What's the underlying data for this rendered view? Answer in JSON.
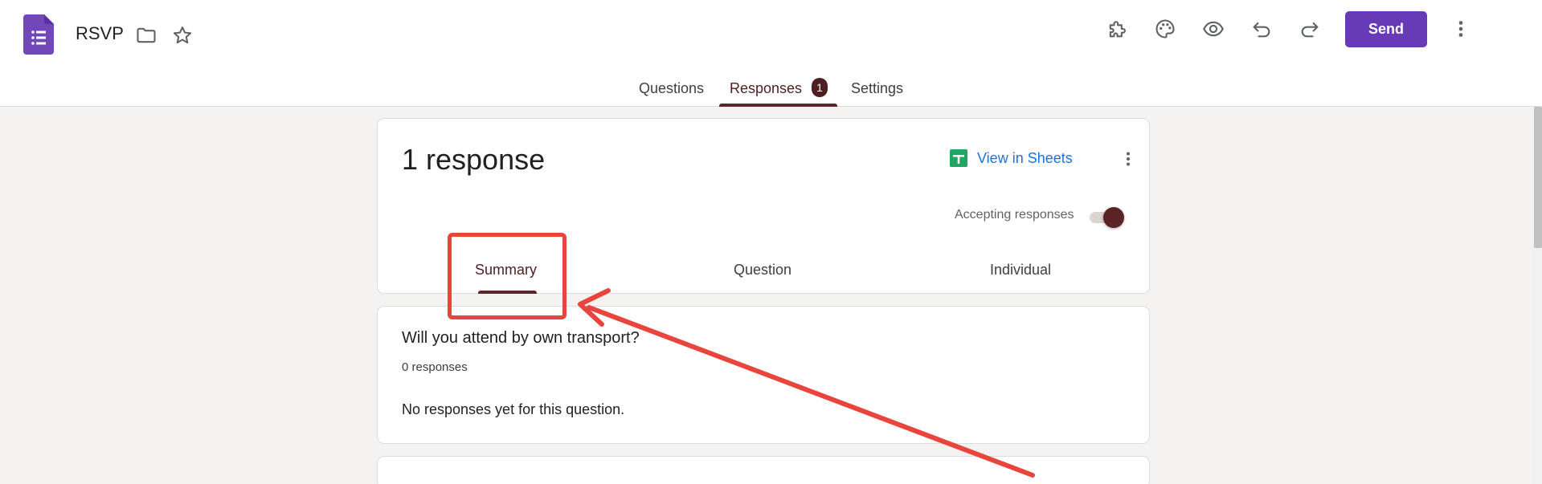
{
  "header": {
    "title": "RSVP",
    "send_label": "Send",
    "icons": [
      "forms-logo-icon",
      "folder-icon",
      "star-icon",
      "addon-puzzle-icon",
      "palette-icon",
      "preview-eye-icon",
      "undo-icon",
      "redo-icon",
      "more-vert-icon"
    ],
    "tabs": [
      {
        "label": "Questions",
        "active": false
      },
      {
        "label": "Responses",
        "active": true,
        "badge": "1"
      },
      {
        "label": "Settings",
        "active": false
      }
    ]
  },
  "summary_card": {
    "count_label": "1 response",
    "view_sheets_label": "View in Sheets",
    "accepting_label": "Accepting responses",
    "accepting_enabled": true,
    "subtabs": [
      {
        "label": "Summary",
        "active": true
      },
      {
        "label": "Question",
        "active": false
      },
      {
        "label": "Individual",
        "active": false
      }
    ]
  },
  "question_card": {
    "title": "Will you attend by own transport?",
    "count": "0 responses",
    "empty_text": "No responses yet for this question."
  },
  "colors": {
    "brand_purple": "#673ab7",
    "accent_maroon": "#5c2426",
    "link_blue": "#1a73e8",
    "annotation_red": "#e8453c",
    "page_bg": "#f4f3f2"
  }
}
